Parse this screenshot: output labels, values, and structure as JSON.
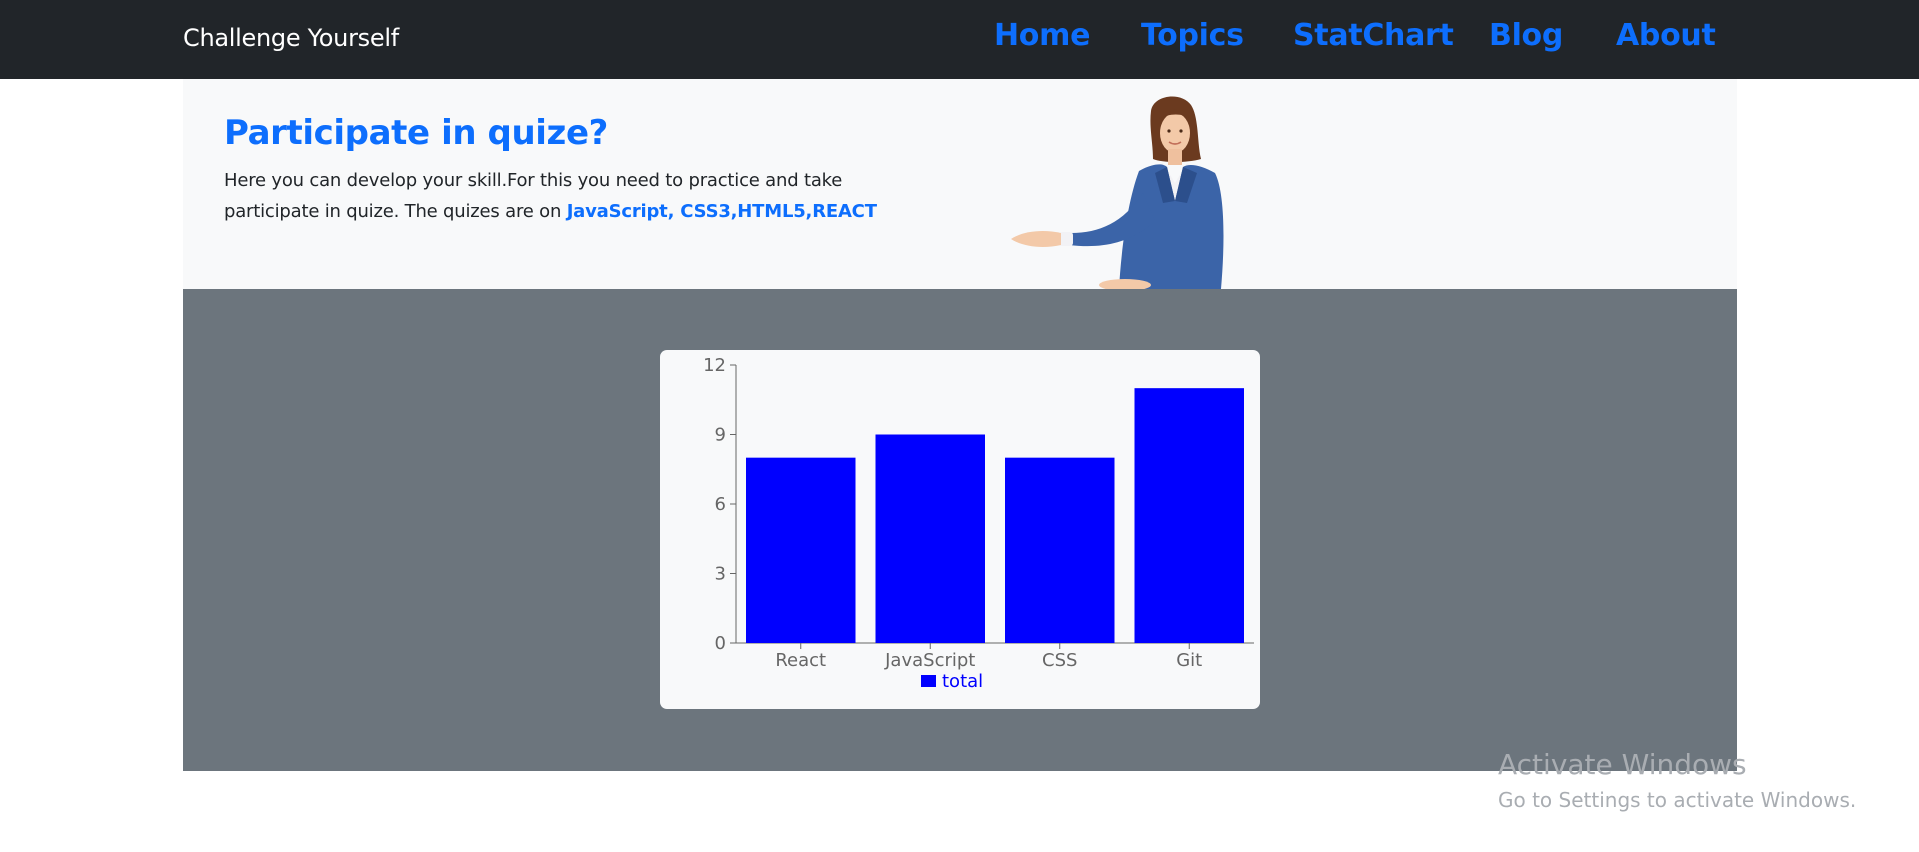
{
  "navbar": {
    "brand": "Challenge Yourself",
    "links": [
      "Home",
      "Topics",
      "StatChart",
      "Blog",
      "About"
    ],
    "link_color": "#0d6efd",
    "background": "#212529"
  },
  "hero": {
    "title": "Participate in quize?",
    "text_line1": "Here you can develop your skill.For this you need to practice and take",
    "text_line2_prefix": "participate in quize. The quizes are on ",
    "highlight": "JavaScript, CSS3,HTML5,REACT",
    "image_icon": "woman-presenting-icon"
  },
  "chart_data": {
    "type": "bar",
    "categories": [
      "React",
      "JavaScript",
      "CSS",
      "Git"
    ],
    "series": [
      {
        "name": "total",
        "values": [
          8,
          9,
          8,
          11
        ],
        "color": "#0000ff"
      }
    ],
    "yticks": [
      "0",
      "3",
      "6",
      "9",
      "12"
    ],
    "ylim": [
      0,
      12
    ],
    "legend": "bottom-center",
    "grid": false
  },
  "watermark": {
    "title": "Activate Windows",
    "subtitle": "Go to Settings to activate Windows."
  }
}
